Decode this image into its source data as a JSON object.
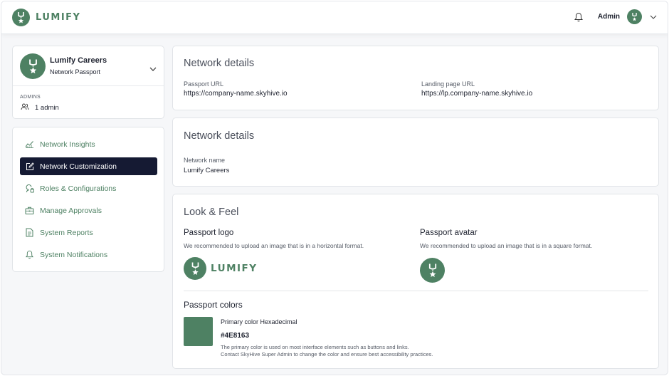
{
  "brand": {
    "wordmark": "LUMIFY"
  },
  "header": {
    "user_label": "Admin"
  },
  "org": {
    "name": "Lumify Careers",
    "subtitle": "Network Passport",
    "admins_heading": "ADMINS",
    "admins_count": "1 admin"
  },
  "sidebar": {
    "items": [
      {
        "label": "Network Insights",
        "icon": "chart-icon",
        "active": false
      },
      {
        "label": "Network Customization",
        "icon": "edit-icon",
        "active": true
      },
      {
        "label": "Roles & Configurations",
        "icon": "user-lock-icon",
        "active": false
      },
      {
        "label": "Manage Approvals",
        "icon": "briefcase-icon",
        "active": false
      },
      {
        "label": "System Reports",
        "icon": "document-icon",
        "active": false
      },
      {
        "label": "System Notifications",
        "icon": "bell-icon",
        "active": false
      }
    ]
  },
  "network_urls": {
    "title": "Network details",
    "passport_url_label": "Passport URL",
    "passport_url": "https://company-name.skyhive.io",
    "landing_url_label": "Landing page URL",
    "landing_url": "https://lp.company-name.skyhive.io"
  },
  "network_name": {
    "title": "Network details",
    "label": "Network name",
    "value": "Lumify Careers"
  },
  "look_feel": {
    "title": "Look & Feel",
    "logo_title": "Passport logo",
    "logo_desc": "We recommended to upload an image that is in a horizontal format.",
    "logo_wordmark": "LUMIFY",
    "avatar_title": "Passport avatar",
    "avatar_desc": "We recommended to upload an image that is in a square format.",
    "colors_title": "Passport colors",
    "primary_label": "Primary color Hexadecimal",
    "primary_hex": "#4E8163",
    "primary_note_1": "The primary color is used on most interface elements such as buttons and links.",
    "primary_note_2": "Contact SkyHive Super Admin to change the color and ensure best accessibility practices."
  },
  "colors": {
    "brand": "#4E8163",
    "nav_active": "#151a33"
  }
}
